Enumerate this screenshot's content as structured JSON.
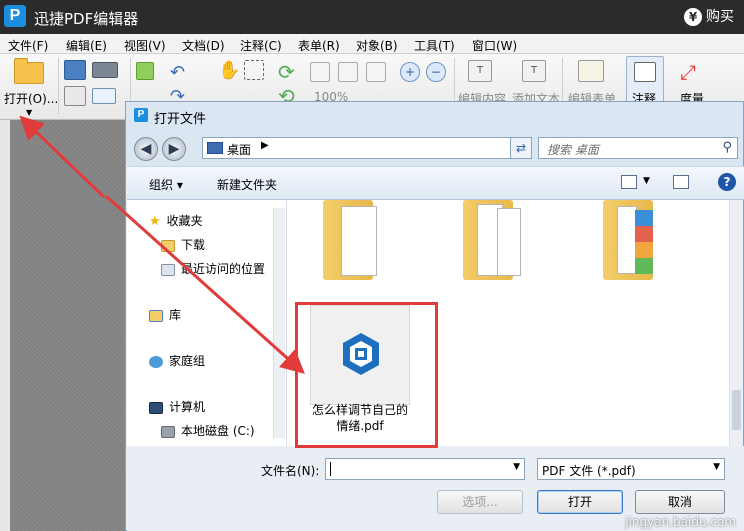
{
  "app": {
    "title": "迅捷PDF编辑器",
    "logo_letter": "P",
    "buy_label": "购买",
    "buy_icon_text": "¥"
  },
  "menu": [
    "文件(F)",
    "编辑(E)",
    "视图(V)",
    "文档(D)",
    "注释(C)",
    "表单(R)",
    "对象(B)",
    "工具(T)",
    "窗口(W)"
  ],
  "toolbar": {
    "open_label": "打开(O)...",
    "zoom_value": "100%",
    "labels": [
      "编辑内容",
      "添加文本",
      "编辑表单",
      "注释",
      "度量"
    ]
  },
  "dialog": {
    "title": "打开文件",
    "address": "桌面",
    "search_placeholder": "搜索 桌面",
    "organize_label": "组织 ▾",
    "new_folder_label": "新建文件夹",
    "nav_items": [
      "收藏夹",
      "下载",
      "最近访问的位置",
      "库",
      "家庭组",
      "计算机",
      "本地磁盘 (C:)"
    ],
    "file_name_line1": "怎么样调节自己的",
    "file_name_line2": "情绪.pdf",
    "file_name_label": "文件名(N):",
    "file_name_value": "",
    "file_type": "PDF 文件 (*.pdf)",
    "options_label": "选项...",
    "open_label": "打开",
    "cancel_label": "取消"
  },
  "watermark": "jingyan.baidu.com",
  "colors": {
    "accent_red": "#e23b3b",
    "title_bg": "#2b2b2b",
    "logo_blue": "#1a8fe0"
  }
}
